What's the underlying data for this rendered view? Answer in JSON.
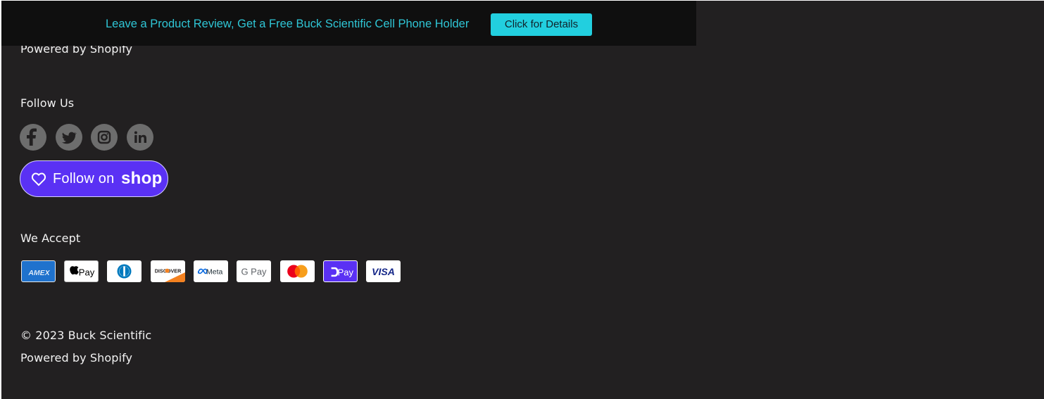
{
  "announcement": {
    "text": "Leave a Product Review, Get a Free Buck Scientific Cell Phone Holder",
    "button_label": "Click for Details",
    "text_color": "#2fc6d6",
    "button_color": "#22cfdf"
  },
  "footer": {
    "background_color": "#222021",
    "clipped_powered_text": "Powered by Shopify",
    "follow_heading": "Follow Us",
    "social_links": [
      {
        "name": "facebook",
        "icon": "facebook-icon"
      },
      {
        "name": "twitter",
        "icon": "twitter-icon"
      },
      {
        "name": "instagram",
        "icon": "instagram-icon"
      },
      {
        "name": "linkedin",
        "icon": "linkedin-icon"
      }
    ],
    "shop_follow": {
      "label": "Follow on",
      "wordmark": "shop",
      "icon": "heart-icon",
      "color": "#5a31f4"
    },
    "accept_heading": "We Accept",
    "payment_methods": [
      {
        "name": "American Express",
        "mark": "AMEX"
      },
      {
        "name": "Apple Pay",
        "mark": "Pay"
      },
      {
        "name": "Diners Club",
        "mark": ""
      },
      {
        "name": "Discover",
        "mark": "DISCOVER"
      },
      {
        "name": "Meta Pay",
        "mark": "Meta"
      },
      {
        "name": "Google Pay",
        "mark": "G Pay"
      },
      {
        "name": "Mastercard",
        "mark": ""
      },
      {
        "name": "Shop Pay",
        "mark": "Pay"
      },
      {
        "name": "Visa",
        "mark": "VISA"
      }
    ],
    "copyright": "© 2023 Buck Scientific",
    "powered_by": "Powered by Shopify"
  }
}
